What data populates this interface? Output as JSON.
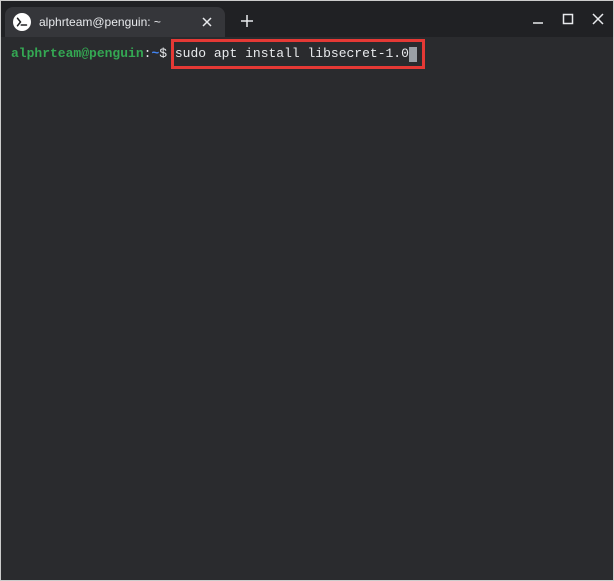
{
  "tab": {
    "title": "alphrteam@penguin: ~"
  },
  "terminal": {
    "prompt": {
      "userhost": "alphrteam@penguin",
      "separator": ":",
      "path": "~",
      "symbol": "$"
    },
    "command": "sudo apt install libsecret-1.0"
  },
  "colors": {
    "highlight_border": "#e53935",
    "prompt_green": "#34a853",
    "prompt_blue": "#4285f4",
    "terminal_bg": "#2a2b2e",
    "titlebar_bg": "#202124"
  }
}
